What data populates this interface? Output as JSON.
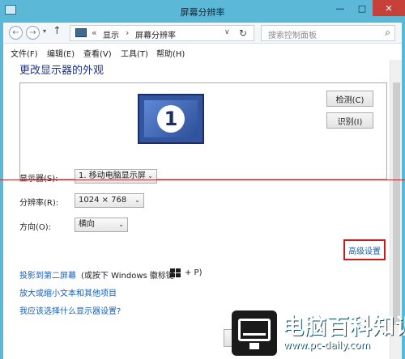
{
  "window": {
    "title": "屏幕分辨率",
    "minimize": "—",
    "maximize": "□",
    "close": "✕"
  },
  "nav": {
    "back": "←",
    "forward": "→",
    "recent": "▾",
    "up": "↑",
    "address": {
      "sep1": "«",
      "crumb1": "显示",
      "sep2": "›",
      "crumb2": "屏幕分辨率",
      "dropdown": "∨",
      "refresh": "↻"
    },
    "search_placeholder": "搜索控制面板",
    "search_glyph": "⌕"
  },
  "menu": {
    "file": "文件(F)",
    "edit": "编辑(E)",
    "view": "查看(V)",
    "tools": "工具(T)",
    "help": "帮助(H)"
  },
  "main": {
    "heading": "更改显示器的外观",
    "monitor_number": "1",
    "detect_label": "检测(C)",
    "identify_label": "识别(I)",
    "display_label": "显示器(S):",
    "display_value": "1. 移动电脑显示屏",
    "resolution_label": "分辨率(R):",
    "resolution_value": "1024 × 768",
    "orientation_label": "方向(O):",
    "orientation_value": "横向",
    "dropdown_glyph": "⌄",
    "advanced_link": "高级设置",
    "project_link": "投影到第二屏幕",
    "project_hint_a": "(或按下 Windows 徽标键",
    "project_hint_b": "+ P)",
    "textsize_link": "放大或缩小文本和其他项目",
    "which_settings_link": "我应该选择什么显示器设置?"
  },
  "watermark": {
    "title": "电脑百科知识",
    "url": "www.pc-daily.com"
  },
  "colors": {
    "link": "#1a5fb4",
    "heading": "#1e3287",
    "highlight_border": "#d01818",
    "frame": "#5bb8d6"
  }
}
